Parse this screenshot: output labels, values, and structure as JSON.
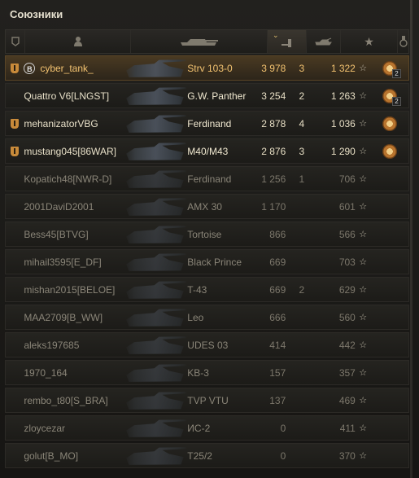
{
  "panel": {
    "title": "Союзники"
  },
  "header": {
    "columns": [
      "badge-column-icon",
      "player-column-icon",
      "tank-column-icon",
      "damage-column-icon",
      "frags-column-icon",
      "xp-column-icon",
      "achievements-column-icon"
    ]
  },
  "rows": [
    {
      "player": "cyber_tank_",
      "tank": "Strv 103-0",
      "damage": "3 978",
      "frags": "3",
      "xp": "1 322",
      "medal": true,
      "medal_count": "2",
      "badge": true,
      "b_icon": "B",
      "state": "me"
    },
    {
      "player": "Quattro V6[LNGST]",
      "tank": "G.W. Panther",
      "damage": "3 254",
      "frags": "2",
      "xp": "1 263",
      "medal": true,
      "medal_count": "2",
      "badge": false,
      "state": "alive"
    },
    {
      "player": "mehanizatorVBG",
      "tank": "Ferdinand",
      "damage": "2 878",
      "frags": "4",
      "xp": "1 036",
      "medal": true,
      "medal_count": "",
      "badge": true,
      "state": "alive"
    },
    {
      "player": "mustang045[86WAR]",
      "tank": "M40/M43",
      "damage": "2 876",
      "frags": "3",
      "xp": "1 290",
      "medal": true,
      "medal_count": "",
      "badge": true,
      "state": "alive"
    },
    {
      "player": "Kopatich48[NWR-D]",
      "tank": "Ferdinand",
      "damage": "1 256",
      "frags": "1",
      "xp": "706",
      "medal": false,
      "medal_count": "",
      "badge": false,
      "state": "dead"
    },
    {
      "player": "2001DaviD2001",
      "tank": "AMX 30",
      "damage": "1 170",
      "frags": "",
      "xp": "601",
      "medal": false,
      "medal_count": "",
      "badge": false,
      "state": "dead"
    },
    {
      "player": "Bess45[BTVG]",
      "tank": "Tortoise",
      "damage": "866",
      "frags": "",
      "xp": "566",
      "medal": false,
      "medal_count": "",
      "badge": false,
      "state": "dead"
    },
    {
      "player": "mihail3595[E_DF]",
      "tank": "Black Prince",
      "damage": "669",
      "frags": "",
      "xp": "703",
      "medal": false,
      "medal_count": "",
      "badge": false,
      "state": "dead"
    },
    {
      "player": "mishan2015[BELOE]",
      "tank": "T-43",
      "damage": "669",
      "frags": "2",
      "xp": "629",
      "medal": false,
      "medal_count": "",
      "badge": false,
      "state": "dead"
    },
    {
      "player": "MAA2709[B_WW]",
      "tank": "Leo",
      "damage": "666",
      "frags": "",
      "xp": "560",
      "medal": false,
      "medal_count": "",
      "badge": false,
      "state": "dead"
    },
    {
      "player": "aleks197685",
      "tank": "UDES 03",
      "damage": "414",
      "frags": "",
      "xp": "442",
      "medal": false,
      "medal_count": "",
      "badge": false,
      "state": "dead"
    },
    {
      "player": "1970_164",
      "tank": "KB-3",
      "damage": "157",
      "frags": "",
      "xp": "357",
      "medal": false,
      "medal_count": "",
      "badge": false,
      "state": "dead"
    },
    {
      "player": "rembo_t80[S_BRA]",
      "tank": "TVP VTU",
      "damage": "137",
      "frags": "",
      "xp": "469",
      "medal": false,
      "medal_count": "",
      "badge": false,
      "state": "dead"
    },
    {
      "player": "zloycezar",
      "tank": "ИС-2",
      "damage": "0",
      "frags": "",
      "xp": "411",
      "medal": false,
      "medal_count": "",
      "badge": false,
      "state": "dead"
    },
    {
      "player": "golut[B_MO]",
      "tank": "T25/2",
      "damage": "0",
      "frags": "",
      "xp": "370",
      "medal": false,
      "medal_count": "",
      "badge": false,
      "state": "dead"
    }
  ],
  "colors": {
    "accent": "#f2c270",
    "me_row": "#4a3a22"
  }
}
